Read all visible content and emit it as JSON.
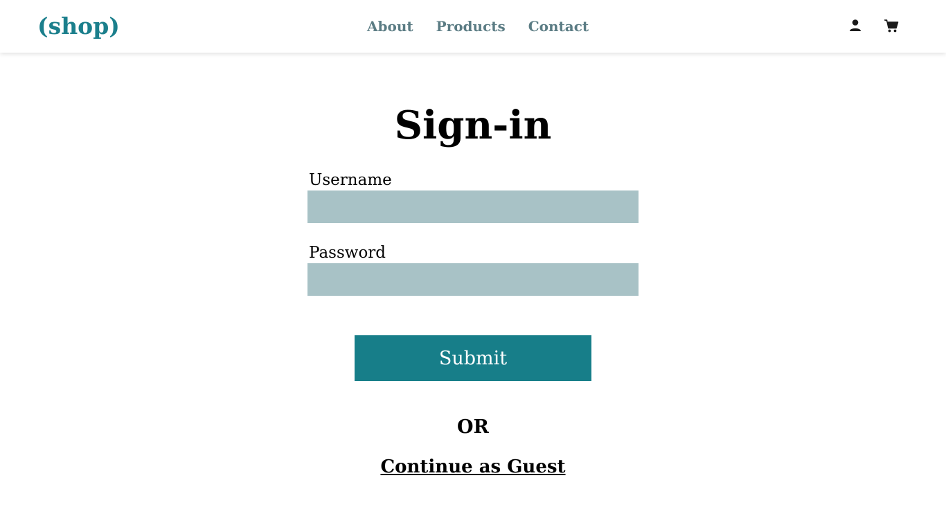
{
  "header": {
    "logo": "(shop)",
    "nav": [
      "About",
      "Products",
      "Contact"
    ],
    "icons": [
      "user-icon",
      "cart-icon"
    ]
  },
  "form": {
    "title": "Sign-in",
    "username_label": "Username",
    "username_value": "",
    "password_label": "Password",
    "password_value": "",
    "submit_label": "Submit",
    "or_text": "OR",
    "guest_link": "Continue as Guest"
  },
  "colors": {
    "brand": "#1b7f8c",
    "nav_text": "#5b7c84",
    "input_bg": "#a8c2c6",
    "button_bg": "#177e89"
  }
}
